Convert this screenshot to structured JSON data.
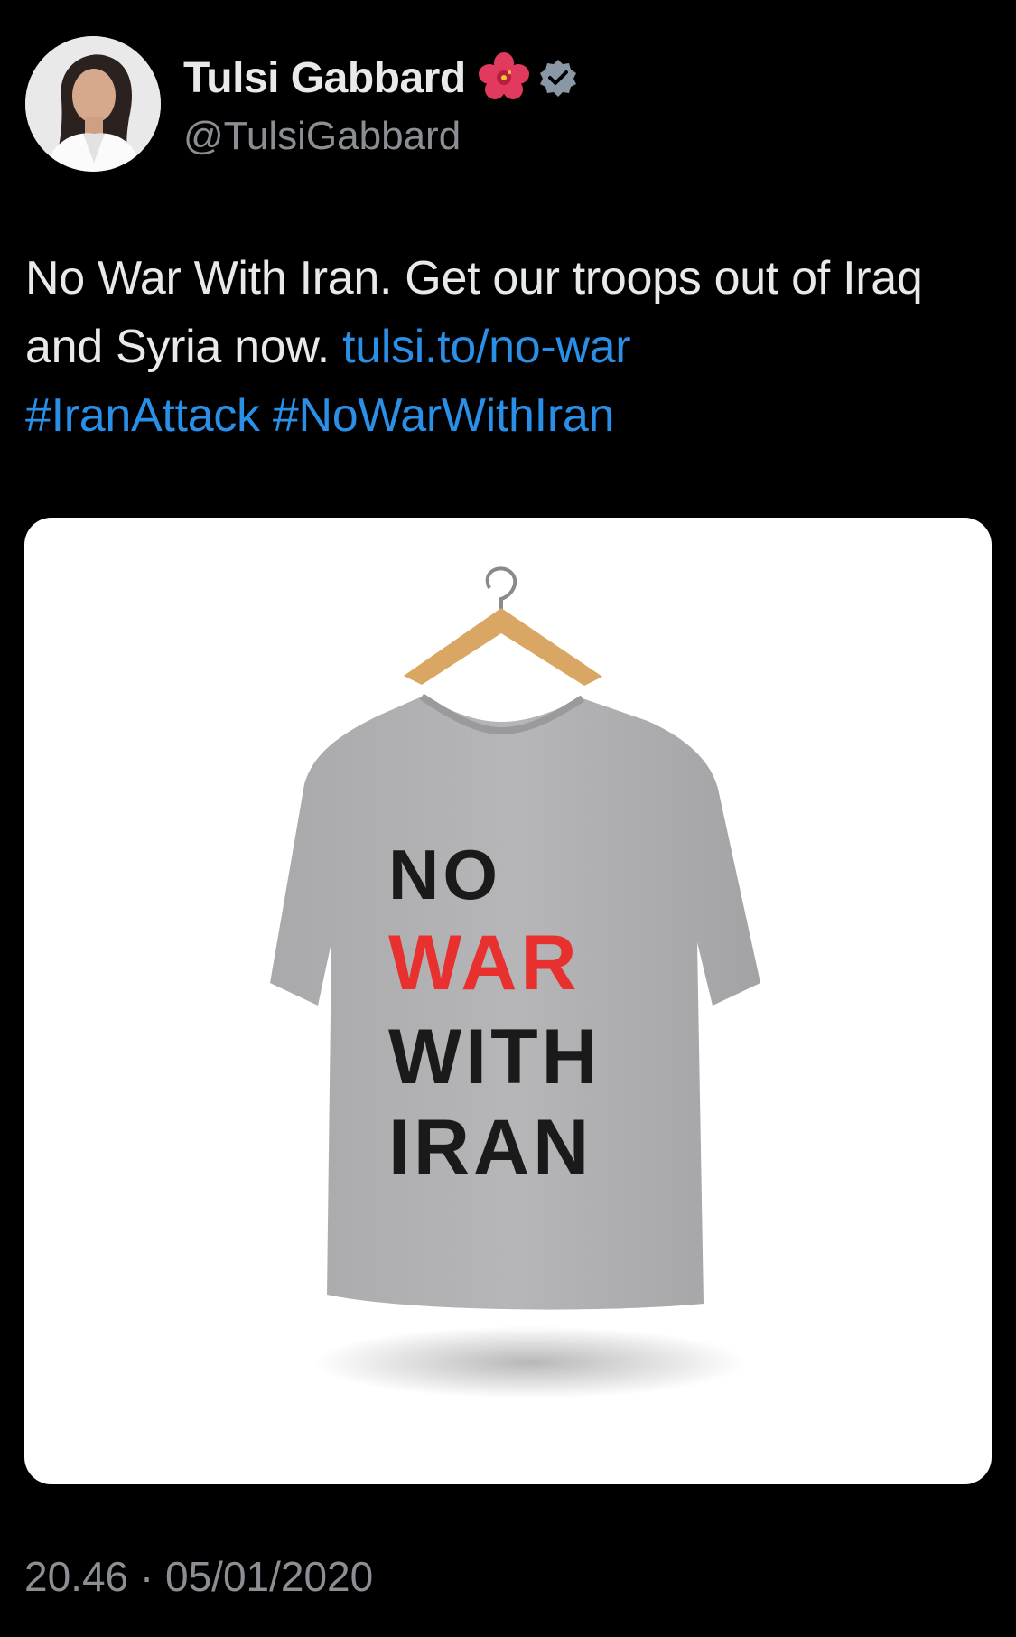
{
  "author": {
    "display_name": "Tulsi Gabbard",
    "handle": "@TulsiGabbard",
    "name_emoji_icon": "hibiscus-flower-icon",
    "verified_icon": "verified-badge-icon",
    "verified_color": "#8a98a6"
  },
  "tweet": {
    "text_plain": "No War With Iran. Get our troops out of Iraq and Syria now.",
    "link": "tulsi.to/no-war",
    "hashtags": [
      "#IranAttack",
      "#NoWarWithIran"
    ],
    "link_color": "#2a8fe6"
  },
  "media": {
    "shirt_text": {
      "line1": "NO",
      "line2": "WAR",
      "line3": "WITH",
      "line4": "IRAN"
    },
    "shirt_text_colors": {
      "black": "#1a1a1a",
      "red": "#e8302e"
    }
  },
  "timestamp": "20.46 · 05/01/2020"
}
